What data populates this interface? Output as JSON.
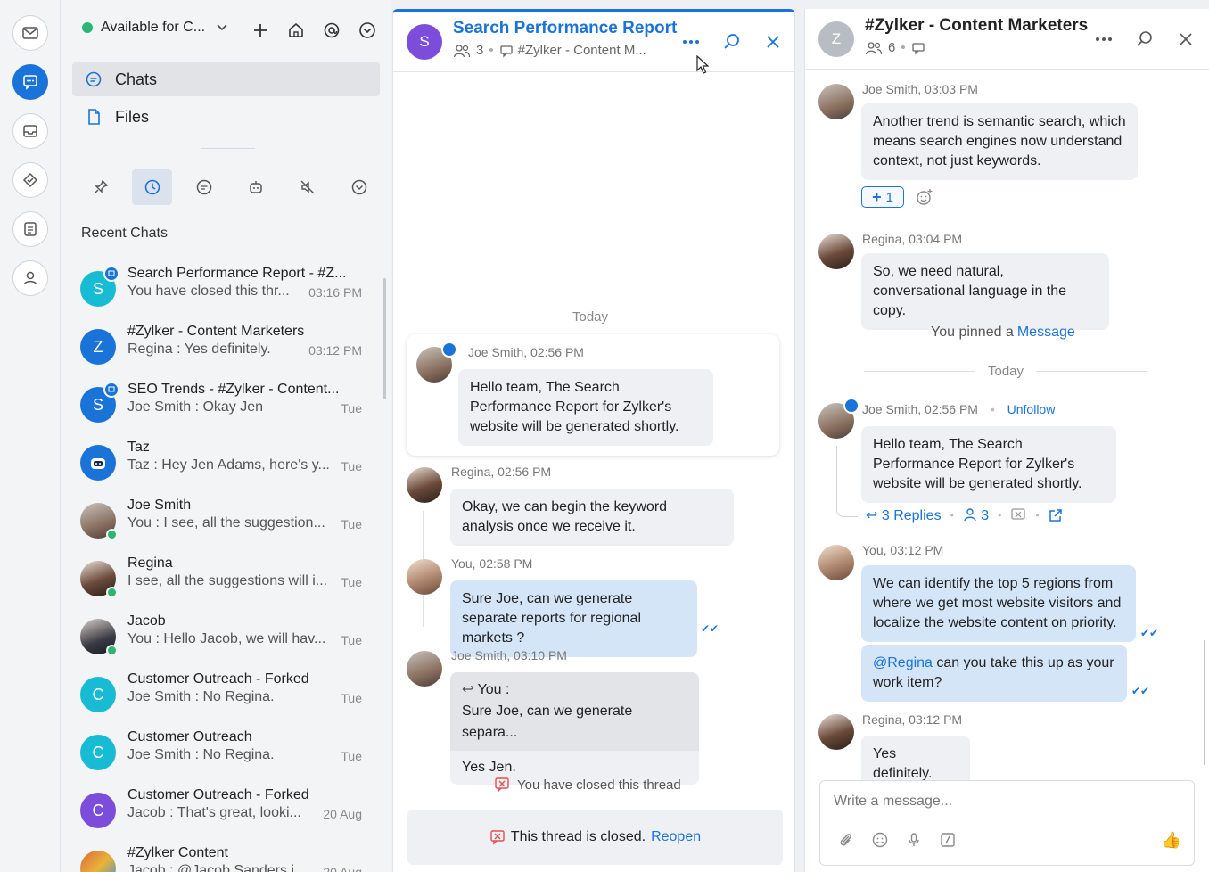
{
  "rail": {
    "items": [
      "mail-icon",
      "chat-icon",
      "inbox-icon",
      "tasks-icon",
      "notes-icon",
      "contacts-icon"
    ]
  },
  "sidebar": {
    "status": "Available for C...",
    "nav": [
      {
        "label": "Chats"
      },
      {
        "label": "Files"
      }
    ],
    "recent_title": "Recent Chats",
    "chats": [
      {
        "name": "Search Performance Report - #Z...",
        "preview": "You have closed this thr...",
        "time": "03:16 PM",
        "initial": "S",
        "color": "#17bcd4"
      },
      {
        "name": "#Zylker - Content Marketers",
        "preview": "Regina : Yes definitely.",
        "time": "03:12 PM",
        "initial": "Z",
        "color": "#1a73d9"
      },
      {
        "name": "SEO Trends - #Zylker - Content...",
        "preview": "Joe Smith : Okay Jen",
        "time": "Tue",
        "initial": "S",
        "color": "#1a73d9"
      },
      {
        "name": "Taz",
        "preview": "Taz : Hey Jen Adams, here's y...",
        "time": "Tue",
        "initial": "",
        "color": "#1a73d9"
      },
      {
        "name": "Joe Smith",
        "preview": "You : I see, all the suggestion...",
        "time": "Tue",
        "initial": "",
        "color": "#8a7060"
      },
      {
        "name": "Regina",
        "preview": "I see, all the suggestions will i...",
        "time": "Tue",
        "initial": "",
        "color": "#6b4a3a"
      },
      {
        "name": "Jacob",
        "preview": "You : Hello Jacob, we will hav...",
        "time": "Tue",
        "initial": "",
        "color": "#3a3a44"
      },
      {
        "name": "Customer Outreach - Forked",
        "preview": "Joe Smith : No Regina.",
        "time": "Tue",
        "initial": "C",
        "color": "#17bcd4"
      },
      {
        "name": "Customer Outreach",
        "preview": "Joe Smith : No Regina.",
        "time": "Tue",
        "initial": "C",
        "color": "#17bcd4"
      },
      {
        "name": "Customer Outreach - Forked",
        "preview": "Jacob : That's great, looki...",
        "time": "20 Aug",
        "initial": "C",
        "color": "#7c4ddb"
      },
      {
        "name": "#Zylker Content",
        "preview": "Jacob : @Jacob Sanders i...",
        "time": "20 Aug",
        "initial": "",
        "color": "#d9693a"
      }
    ]
  },
  "thread": {
    "title": "Search Performance Report",
    "avatar_initial": "S",
    "members": "3",
    "channel": "#Zylker - Content M...",
    "day": "Today",
    "messages": [
      {
        "meta": "Joe Smith, 02:56 PM",
        "text": "Hello team, The Search Performance Report for Zylker's website will be generated shortly."
      },
      {
        "meta": "Regina, 02:56 PM",
        "text": "Okay, we can begin the keyword analysis once we receive it."
      },
      {
        "meta": "You, 02:58 PM",
        "text": "Sure Joe, can we generate separate reports for regional markets ?"
      },
      {
        "meta": "Joe Smith, 03:10 PM",
        "quote_author": "You :",
        "quote_text": "Sure Joe, can we generate separa...",
        "text": "Yes Jen."
      }
    ],
    "closed_note": "You have closed this thread",
    "closed_bar": "This thread is closed.",
    "reopen": "Reopen"
  },
  "channel": {
    "title": "#Zylker - Content Marketers",
    "avatar_initial": "Z",
    "members": "6",
    "messages": [
      {
        "meta": "Joe Smith, 03:03 PM",
        "text": "Another trend is semantic search, which means search engines now understand context, not just keywords."
      },
      {
        "meta": "Regina, 03:04 PM",
        "text": "So, we need natural, conversational language in the copy."
      },
      {
        "meta": "Joe Smith, 02:56 PM",
        "text": "Hello team, The Search Performance Report for Zylker's website will be generated shortly."
      },
      {
        "meta": "You, 03:12 PM",
        "text": "We can identify the top 5 regions from where we get most website visitors and localize the website content on priority."
      },
      {
        "mention": "@Regina",
        "text": " can you take this up as your work item?"
      },
      {
        "meta": "Regina, 03:12 PM",
        "text": "Yes definitely."
      }
    ],
    "reaction_count": "1",
    "pinned_prefix": "You pinned a",
    "pinned_link": "Message",
    "day": "Today",
    "unfollow": "Unfollow",
    "replies": "3 Replies",
    "participants": "3",
    "composer_placeholder": "Write a message..."
  }
}
